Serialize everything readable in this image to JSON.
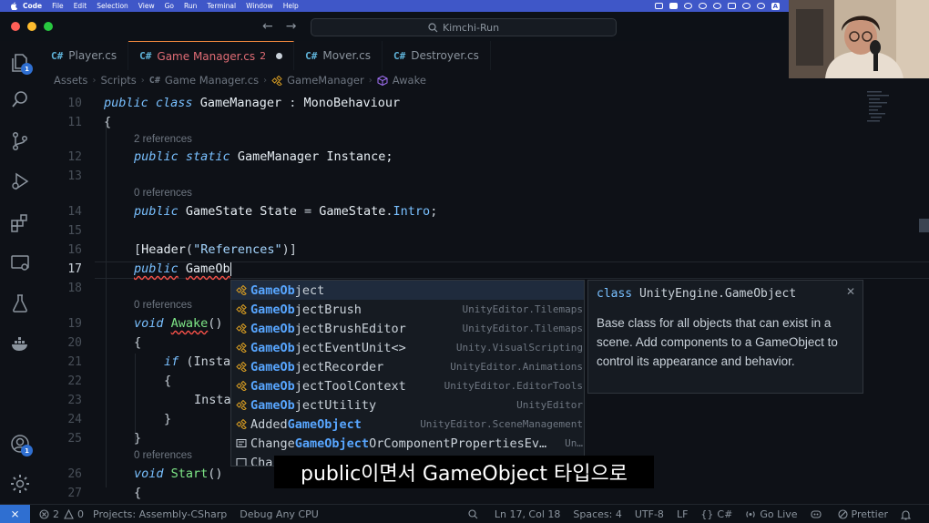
{
  "menubar": {
    "items": [
      "Code",
      "File",
      "Edit",
      "Selection",
      "View",
      "Go",
      "Run",
      "Terminal",
      "Window",
      "Help"
    ],
    "input_badge": "A"
  },
  "titlebar": {
    "search_text": "Kimchi-Run"
  },
  "activity": {
    "explorer_badge": "1",
    "accounts_badge": "1"
  },
  "tabs": [
    {
      "label": "Player.cs"
    },
    {
      "label": "Game Manager.cs",
      "problems": "2"
    },
    {
      "label": "Mover.cs"
    },
    {
      "label": "Destroyer.cs"
    }
  ],
  "breadcrumb": [
    "Assets",
    "Scripts",
    "Game Manager.cs",
    "GameManager",
    "Awake"
  ],
  "editor": {
    "line_numbers": [
      "10",
      "11",
      "12",
      "13",
      "14",
      "15",
      "16",
      "17",
      "18",
      "19",
      "20",
      "21",
      "22",
      "23",
      "24",
      "25",
      "26",
      "27"
    ],
    "codelens": [
      "2 references",
      "0 references",
      "0 references",
      "0 references"
    ],
    "code": {
      "l10_public": "public",
      "l10_class": "class",
      "l10_name": "GameManager",
      "l10_colon": " : ",
      "l10_base": "MonoBehaviour",
      "l11": "{",
      "l12_public": "public",
      "l12_static": "static",
      "l12_type": "GameManager",
      "l12_name": "Instance;",
      "l14_public": "public",
      "l14_type": "GameState",
      "l14_name": "State",
      "l14_eq": " = ",
      "l14_enum": "GameState",
      "l14_member": "Intro",
      "l14_end": ";",
      "l16_open": "[",
      "l16_attr": "Header",
      "l16_paren": "(",
      "l16_str": "\"References\"",
      "l16_close": ")]",
      "l17_public": "public",
      "l17_typed": "GameOb",
      "l19_void": "void",
      "l19_name": "Awake",
      "l19_paren": "()",
      "l20": "{",
      "l21_if": "if",
      "l21_rest": " (Insta",
      "l22": "{",
      "l23": "Insta",
      "l24": "}",
      "l25": "}",
      "l26_void": "void",
      "l26_name": "Start",
      "l26_paren": "()",
      "l27": "{"
    }
  },
  "suggestions": [
    {
      "match": "GameOb",
      "rest": "ject",
      "prefix": "",
      "detail": ""
    },
    {
      "match": "GameOb",
      "rest": "jectBrush",
      "prefix": "",
      "detail": "UnityEditor.Tilemaps"
    },
    {
      "match": "GameOb",
      "rest": "jectBrushEditor",
      "prefix": "",
      "detail": "UnityEditor.Tilemaps"
    },
    {
      "match": "GameOb",
      "rest": "jectEventUnit<>",
      "prefix": "",
      "detail": "Unity.VisualScripting"
    },
    {
      "match": "GameOb",
      "rest": "jectRecorder",
      "prefix": "",
      "detail": "UnityEditor.Animations"
    },
    {
      "match": "GameOb",
      "rest": "jectToolContext",
      "prefix": "",
      "detail": "UnityEditor.EditorTools"
    },
    {
      "match": "GameOb",
      "rest": "jectUtility",
      "prefix": "",
      "detail": "UnityEditor"
    },
    {
      "match": "GameObject",
      "rest": "",
      "prefix": "Added",
      "detail": "UnityEditor.SceneManagement"
    },
    {
      "match": "GameObject",
      "rest": "OrComponentPropertiesEv…",
      "prefix": "Change",
      "detail": "Un…"
    },
    {
      "match": "",
      "rest": "",
      "prefix": "Cha",
      "detail": ""
    }
  ],
  "details": {
    "kind": "class",
    "namespace": "UnityEngine",
    "dot": ".",
    "name": "GameObject",
    "doc": "Base class for all objects that can exist in a scene. Add components to a GameObject to control its appearance and behavior."
  },
  "subtitle": "public이면서 GameObject 타입으로",
  "statusbar": {
    "errors": "2",
    "warnings": "0",
    "projects": "Projects: Assembly-CSharp",
    "debug": "Debug Any CPU",
    "position": "Ln 17, Col 18",
    "spaces": "Spaces: 4",
    "encoding": "UTF-8",
    "eol": "LF",
    "language": "C#",
    "golive": "Go Live",
    "prettier": "Prettier"
  },
  "colors": {
    "menubar_bg": "#3f57c8",
    "editor_bg": "#0e1117",
    "accent": "#2f6fd1",
    "error": "#f85149",
    "match": "#58a6ff"
  }
}
